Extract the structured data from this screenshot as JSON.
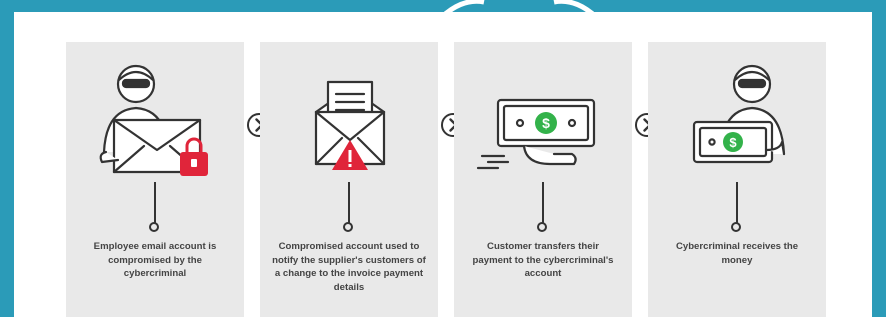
{
  "steps": [
    {
      "caption": "Employee email account is compromised by the cybercriminal"
    },
    {
      "caption": "Compromised account used to notify the supplier's customers of a change to the invoice payment details"
    },
    {
      "caption": "Customer transfers their payment to the cybercriminal's account"
    },
    {
      "caption": "Cybercriminal receives the money"
    }
  ],
  "colors": {
    "background": "#2b9bb8",
    "panel": "#e9e9e9",
    "alert_red": "#e0253a",
    "money_green": "#33b24a",
    "line": "#333333"
  },
  "icons": {
    "next_arrow": "chevron-right-circle-icon",
    "money": "dollar-icon",
    "alert": "exclamation-icon",
    "lock": "lock-icon"
  }
}
